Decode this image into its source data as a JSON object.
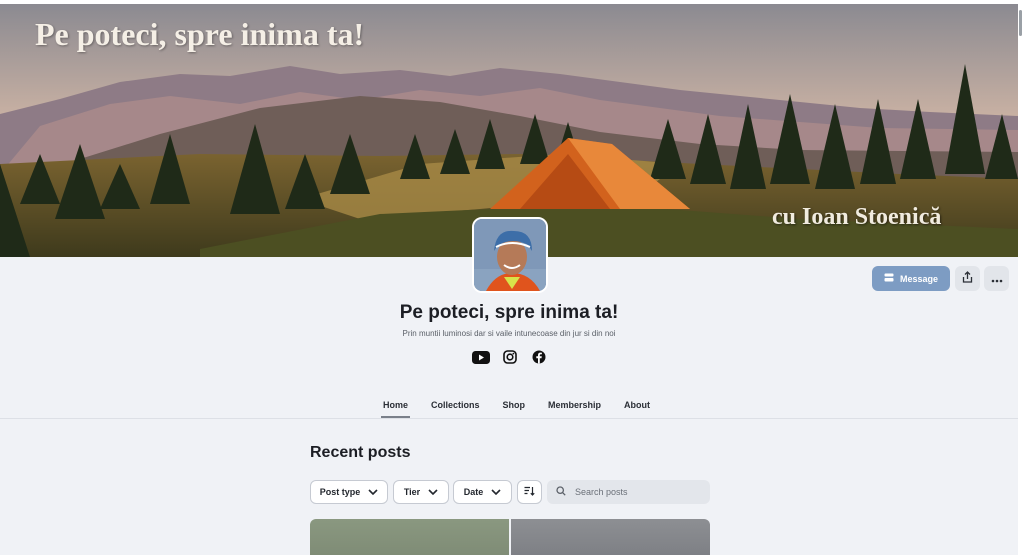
{
  "banner": {
    "title": "Pe poteci, spre inima ta!",
    "author": "cu Ioan Stoenică"
  },
  "creator": {
    "name": "Pe poteci, spre inima ta!",
    "tagline": "Prin muntii luminosi dar si vaile intunecoase din jur si din noi"
  },
  "actions": {
    "message_label": "Message",
    "message_icon": "chat-icon",
    "share_icon": "share-icon",
    "more_icon": "more-horizontal-icon"
  },
  "socials": [
    "youtube-icon",
    "instagram-icon",
    "facebook-icon"
  ],
  "tabs": [
    {
      "label": "Home",
      "active": true
    },
    {
      "label": "Collections",
      "active": false
    },
    {
      "label": "Shop",
      "active": false
    },
    {
      "label": "Membership",
      "active": false
    },
    {
      "label": "About",
      "active": false
    }
  ],
  "posts": {
    "section_title": "Recent posts",
    "filters": {
      "post_type": "Post type",
      "tier": "Tier",
      "date": "Date"
    },
    "sort_icon": "sort-icon",
    "search_placeholder": "Search posts"
  },
  "colors": {
    "accent": "#7d9cc3",
    "page_bg": "#f0f2f6"
  }
}
